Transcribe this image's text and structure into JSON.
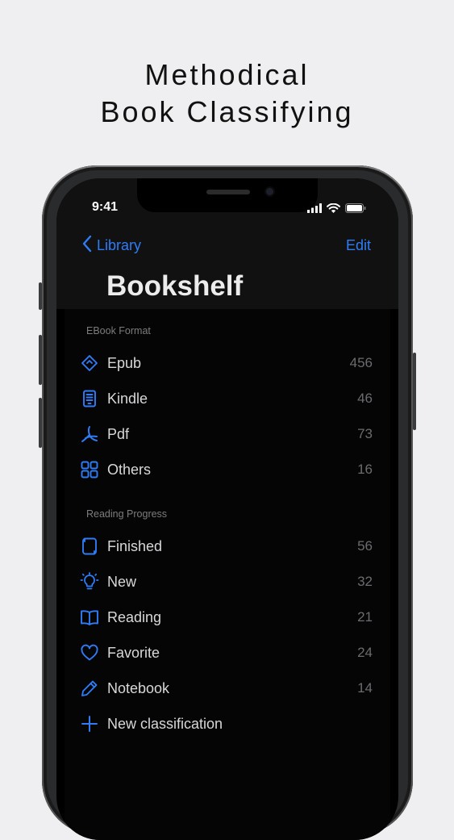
{
  "headline": {
    "line1": "Methodical",
    "line2": "Book Classifying"
  },
  "status_bar": {
    "time": "9:41"
  },
  "nav": {
    "back_label": "Library",
    "edit_label": "Edit"
  },
  "page_title": "Bookshelf",
  "sections": [
    {
      "header": "EBook Format",
      "items": [
        {
          "label": "Epub",
          "count": "456",
          "icon": "epub-icon"
        },
        {
          "label": "Kindle",
          "count": "46",
          "icon": "kindle-icon"
        },
        {
          "label": "Pdf",
          "count": "73",
          "icon": "pdf-icon"
        },
        {
          "label": "Others",
          "count": "16",
          "icon": "grid-icon"
        }
      ]
    },
    {
      "header": "Reading Progress",
      "items": [
        {
          "label": "Finished",
          "count": "56",
          "icon": "finished-book-icon"
        },
        {
          "label": "New",
          "count": "32",
          "icon": "lightbulb-icon"
        },
        {
          "label": "Reading",
          "count": "21",
          "icon": "open-book-icon"
        },
        {
          "label": "Favorite",
          "count": "24",
          "icon": "heart-icon"
        },
        {
          "label": "Notebook",
          "count": "14",
          "icon": "pencil-icon"
        }
      ]
    }
  ],
  "new_classification": {
    "label": "New classification",
    "icon": "plus-icon"
  },
  "colors": {
    "accent": "#2f7cf6",
    "background": "#efeef0",
    "screen": "#000000",
    "text": "#d8d8db",
    "count": "#6c6c70"
  }
}
